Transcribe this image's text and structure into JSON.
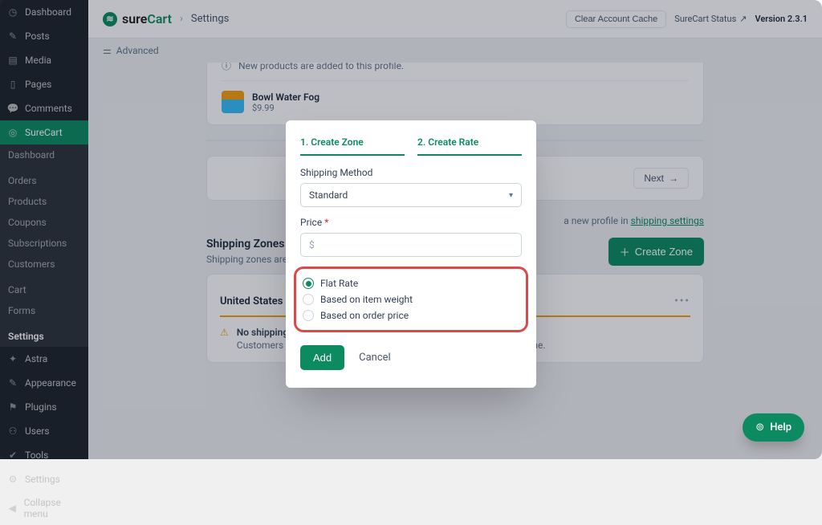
{
  "wp_menu": {
    "dashboard": "Dashboard",
    "posts": "Posts",
    "media": "Media",
    "pages": "Pages",
    "comments": "Comments",
    "surecart": "SureCart",
    "astra": "Astra",
    "appearance": "Appearance",
    "plugins": "Plugins",
    "users": "Users",
    "tools": "Tools",
    "settings": "Settings",
    "collapse": "Collapse menu"
  },
  "sc_submenu": {
    "dashboard": "Dashboard",
    "orders": "Orders",
    "products": "Products",
    "coupons": "Coupons",
    "subscriptions": "Subscriptions",
    "customers": "Customers",
    "cart": "Cart",
    "forms": "Forms",
    "settings": "Settings"
  },
  "topbar": {
    "brand_prefix": "sure",
    "brand_suffix": "Cart",
    "breadcrumb_sep": "›",
    "breadcrumb_current": "Settings",
    "clear_cache": "Clear Account Cache",
    "status_label": "SureCart Status",
    "version": "Version 2.3.1"
  },
  "secnav": {
    "item": "Advanced"
  },
  "profile_panel": {
    "info": "New products are added to this profile.",
    "product_name": "Bowl Water Fog",
    "product_price": "$9.99",
    "next_label": "Next",
    "footer_text_a": "a new profile in ",
    "footer_link": "shipping settings"
  },
  "zones_section": {
    "title": "Shipping Zones & Rates",
    "desc": "Shipping zones are geographic regions where you ship products.",
    "create_zone": "Create Zone",
    "zone_name": "United States",
    "ellipsis": "•••",
    "warn_title": "No shipping rates",
    "warn_desc": "Customers won't be able to complete checkout for products in this zone."
  },
  "modal": {
    "tab1": "1. Create Zone",
    "tab2": "2. Create Rate",
    "method_label": "Shipping Method",
    "method_value": "Standard",
    "price_label": "Price",
    "price_placeholder": "$",
    "radio_flat": "Flat Rate",
    "radio_weight": "Based on item weight",
    "radio_price": "Based on order price",
    "add": "Add",
    "cancel": "Cancel"
  },
  "help_fab": "Help"
}
